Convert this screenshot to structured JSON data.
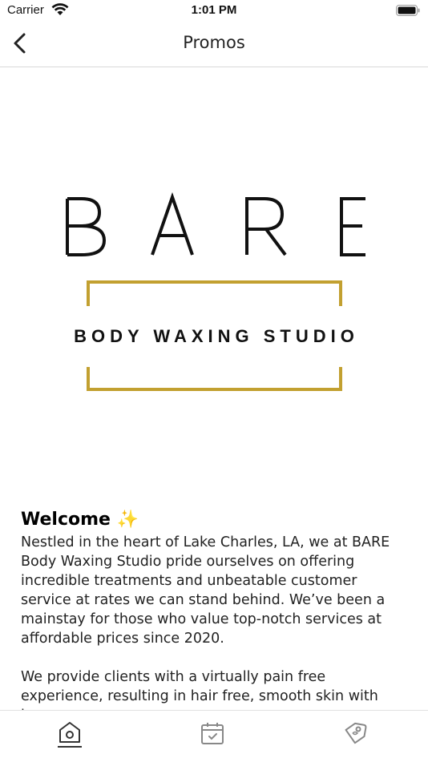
{
  "status_bar": {
    "carrier": "Carrier",
    "time": "1:01 PM"
  },
  "navbar": {
    "title": "Promos",
    "back_icon": "chevron-left-icon"
  },
  "logo": {
    "brand": "BARE",
    "tagline": "BODY WAXING STUDIO",
    "accent_color": "#c2a030"
  },
  "content": {
    "heading": "Welcome",
    "heading_emoji": "✨",
    "paragraphs": [
      "Nestled in the heart of Lake Charles, LA, we at BARE Body Waxing Studio pride ourselves on offering incredible treatments and unbeatable customer service at rates we can stand behind. We’ve been a mainstay for those who value top-notch services at affordable prices since 2020.",
      "We provide clients with a virtually pain free experience, resulting in hair free, smooth skin with long"
    ]
  },
  "tabbar": {
    "items": [
      {
        "icon": "home-icon",
        "active": true
      },
      {
        "icon": "calendar-icon",
        "active": false
      },
      {
        "icon": "tag-icon",
        "active": false
      }
    ]
  }
}
